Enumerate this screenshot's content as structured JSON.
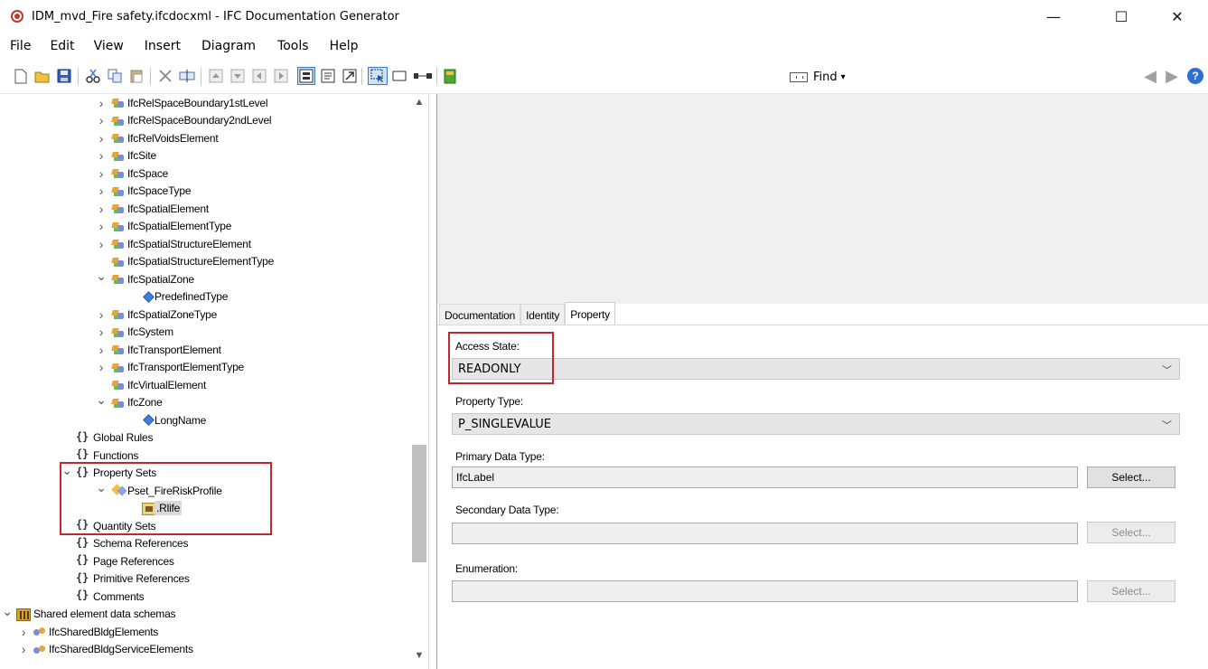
{
  "window": {
    "title": "IDM_mvd_Fire safety.ifcdocxml - IFC Documentation Generator",
    "minimize": "—",
    "maximize": "☐",
    "close": "✕"
  },
  "menu": [
    "File",
    "Edit",
    "View",
    "Insert",
    "Diagram",
    "Tools",
    "Help"
  ],
  "toolbar": {
    "find_label": "Find",
    "find_dropdown": "▾",
    "back": "◀",
    "forward": "▶",
    "help": "?"
  },
  "tree": {
    "rows": [
      {
        "expander": ">",
        "icon": "entity-icon",
        "label": "IfcRelSpaceBoundary1stLevel",
        "level": 2
      },
      {
        "expander": ">",
        "icon": "entity-icon",
        "label": "IfcRelSpaceBoundary2ndLevel",
        "level": 2
      },
      {
        "expander": ">",
        "icon": "entity-icon",
        "label": "IfcRelVoidsElement",
        "level": 2
      },
      {
        "expander": ">",
        "icon": "entity-icon",
        "label": "IfcSite",
        "level": 2
      },
      {
        "expander": ">",
        "icon": "entity-icon",
        "label": "IfcSpace",
        "level": 2
      },
      {
        "expander": ">",
        "icon": "entity-icon",
        "label": "IfcSpaceType",
        "level": 2
      },
      {
        "expander": ">",
        "icon": "entity-icon",
        "label": "IfcSpatialElement",
        "level": 2
      },
      {
        "expander": ">",
        "icon": "entity-icon",
        "label": "IfcSpatialElementType",
        "level": 2
      },
      {
        "expander": ">",
        "icon": "entity-icon",
        "label": "IfcSpatialStructureElement",
        "level": 2
      },
      {
        "expander": "",
        "icon": "entity-icon",
        "label": "IfcSpatialStructureElementType",
        "level": 2
      },
      {
        "expander": "v",
        "icon": "entity-icon",
        "label": "IfcSpatialZone",
        "level": 2
      },
      {
        "expander": "",
        "icon": "attribute-icon",
        "label": "PredefinedType",
        "level": 3
      },
      {
        "expander": ">",
        "icon": "entity-icon",
        "label": "IfcSpatialZoneType",
        "level": 2
      },
      {
        "expander": ">",
        "icon": "entity-icon",
        "label": "IfcSystem",
        "level": 2
      },
      {
        "expander": ">",
        "icon": "entity-icon",
        "label": "IfcTransportElement",
        "level": 2
      },
      {
        "expander": ">",
        "icon": "entity-icon",
        "label": "IfcTransportElementType",
        "level": 2
      },
      {
        "expander": "",
        "icon": "entity-icon",
        "label": "IfcVirtualElement",
        "level": 2
      },
      {
        "expander": "v",
        "icon": "entity-icon",
        "label": "IfcZone",
        "level": 2
      },
      {
        "expander": "",
        "icon": "attribute-icon",
        "label": "LongName",
        "level": 3
      },
      {
        "expander": "",
        "icon": "braces-icon",
        "label": "Global Rules",
        "level": 1
      },
      {
        "expander": "",
        "icon": "braces-icon",
        "label": "Functions",
        "level": 1
      },
      {
        "expander": "v",
        "icon": "braces-icon",
        "label": "Property Sets",
        "level": 1
      },
      {
        "expander": "v",
        "icon": "property-set-icon",
        "label": "Pset_FireRiskProfile",
        "level": 2
      },
      {
        "expander": "",
        "icon": "property-icon",
        "label": ".Rlife",
        "level": 3,
        "selected": true
      },
      {
        "expander": "",
        "icon": "braces-icon",
        "label": "Quantity Sets",
        "level": 1
      },
      {
        "expander": "",
        "icon": "braces-icon",
        "label": "Schema References",
        "level": 1
      },
      {
        "expander": "",
        "icon": "braces-icon",
        "label": "Page References",
        "level": 1
      },
      {
        "expander": "",
        "icon": "braces-icon",
        "label": "Primitive References",
        "level": 1
      },
      {
        "expander": "",
        "icon": "braces-icon",
        "label": "Comments",
        "level": 1
      },
      {
        "expander": "v",
        "icon": "library-icon",
        "label": "Shared element data schemas",
        "level": 0
      },
      {
        "expander": ">",
        "icon": "group-icon",
        "label": "IfcSharedBldgElements",
        "level": 0.5
      },
      {
        "expander": ">",
        "icon": "group-icon",
        "label": "IfcSharedBldgServiceElements",
        "level": 0.5
      }
    ]
  },
  "tabs": [
    "Documentation",
    "Identity",
    "Property"
  ],
  "form": {
    "access_state_label": "Access State:",
    "access_state_value": "READONLY",
    "property_type_label": "Property Type:",
    "property_type_value": "P_SINGLEVALUE",
    "primary_data_type_label": "Primary Data Type:",
    "primary_data_type_value": "IfcLabel",
    "secondary_data_type_label": "Secondary Data Type:",
    "secondary_data_type_value": "",
    "enumeration_label": "Enumeration:",
    "enumeration_value": "",
    "select_label": "Select...",
    "dropdown_arrow": "﹀"
  },
  "colors": {
    "highlight_box": "#c0282d",
    "selected_bg": "#d9d9d9",
    "panel_bg": "#f0f0f0"
  }
}
